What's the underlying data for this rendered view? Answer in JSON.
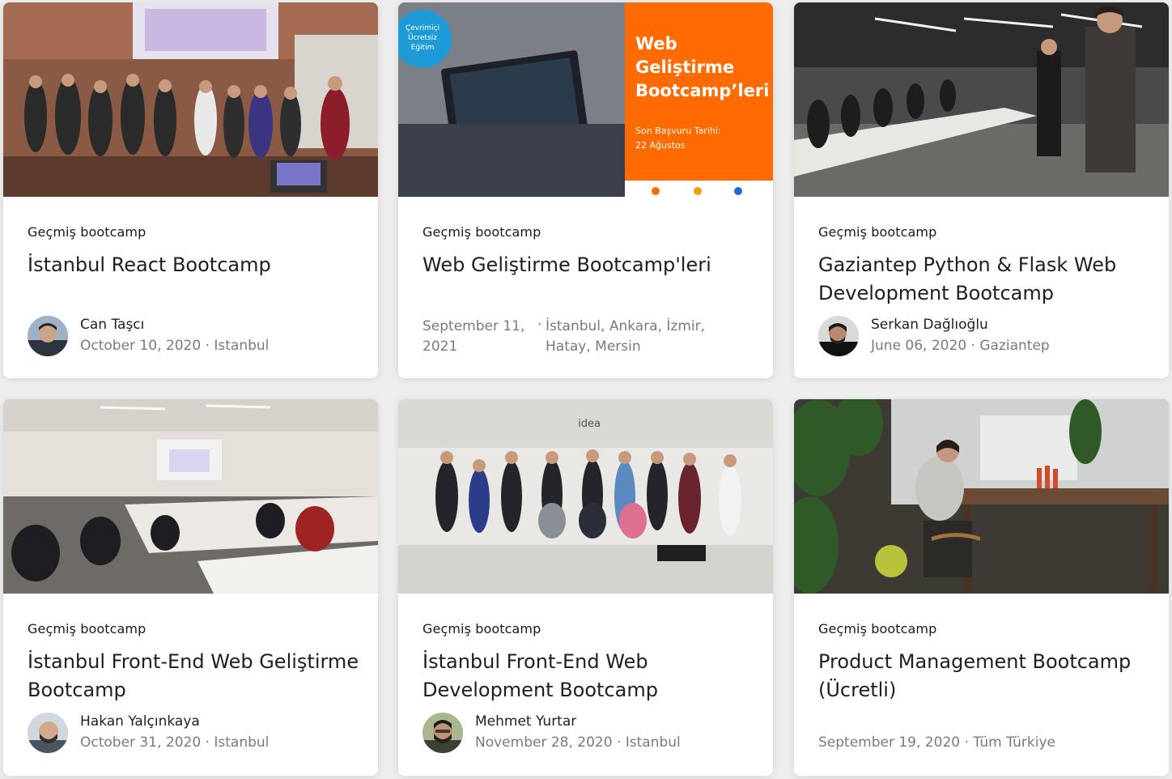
{
  "cards": [
    {
      "tag": "Geçmiş bootcamp",
      "title": "İstanbul React Bootcamp",
      "author": "Can Taşcı",
      "date": "October 10, 2020",
      "separator": "·",
      "location": "Istanbul"
    },
    {
      "tag": "Geçmiş bootcamp",
      "title": "Web Geliştirme Bootcamp'leri",
      "date": "September 11, 2021",
      "separator": "·",
      "location": "İstanbul, Ankara, İzmir, Hatay, Mersin",
      "banner": {
        "badge_line1": "Çevrimiçi",
        "badge_line2": "Ücretsiz",
        "badge_line3": "Eğitim",
        "headline1": "Web",
        "headline2": "Geliştirme",
        "headline3": "Bootcamp’leri",
        "deadline_label": "Son Başvuru Tarihi:",
        "deadline_value": "22 Ağustos",
        "accent_color": "#ff6b00"
      }
    },
    {
      "tag": "Geçmiş bootcamp",
      "title": "Gaziantep Python & Flask Web Development Bootcamp",
      "author": "Serkan Dağlıoğlu",
      "date": "June 06, 2020",
      "separator": "·",
      "location": "Gaziantep"
    },
    {
      "tag": "Geçmiş bootcamp",
      "title": "İstanbul Front-End Web Geliştirme Bootcamp",
      "author": "Hakan Yalçınkaya",
      "date": "October 31, 2020",
      "separator": "·",
      "location": "Istanbul"
    },
    {
      "tag": "Geçmiş bootcamp",
      "title": "İstanbul Front-End Web Development Bootcamp",
      "author": "Mehmet Yurtar",
      "date": "November 28, 2020",
      "separator": "·",
      "location": "Istanbul",
      "photo_sign": "idea"
    },
    {
      "tag": "Geçmiş bootcamp",
      "title": "Product Management Bootcamp (Ücretli)",
      "date": "September 19, 2020",
      "separator": "·",
      "location": "Tüm Türkiye"
    }
  ],
  "icons": {
    "avatar": "user-avatar"
  },
  "colors": {
    "background": "#eeeeee",
    "card": "#ffffff",
    "tag_text": "#1a1a1a",
    "muted_text": "#7a7a7a",
    "banner_orange": "#ff6b00"
  }
}
